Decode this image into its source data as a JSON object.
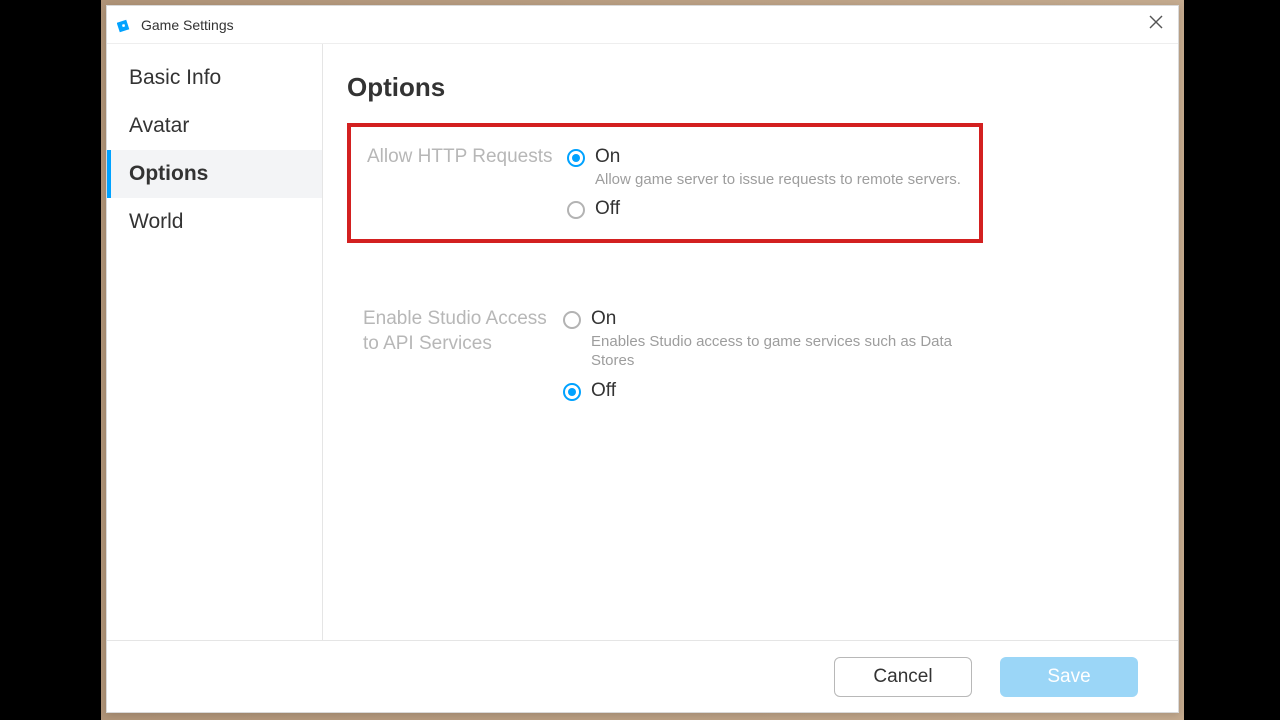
{
  "window": {
    "title": "Game Settings"
  },
  "sidebar": {
    "items": [
      {
        "label": "Basic Info",
        "active": false
      },
      {
        "label": "Avatar",
        "active": false
      },
      {
        "label": "Options",
        "active": true
      },
      {
        "label": "World",
        "active": false
      }
    ]
  },
  "main": {
    "page_title": "Options",
    "settings": [
      {
        "label": "Allow HTTP Requests",
        "highlighted": true,
        "options": [
          {
            "label": "On",
            "desc": "Allow game server to issue requests to remote servers.",
            "checked": true
          },
          {
            "label": "Off",
            "desc": "",
            "checked": false
          }
        ]
      },
      {
        "label": "Enable Studio Access to API Services",
        "highlighted": false,
        "options": [
          {
            "label": "On",
            "desc": "Enables Studio access to game services such as Data Stores",
            "checked": false
          },
          {
            "label": "Off",
            "desc": "",
            "checked": true
          }
        ]
      }
    ]
  },
  "footer": {
    "cancel": "Cancel",
    "save": "Save"
  }
}
